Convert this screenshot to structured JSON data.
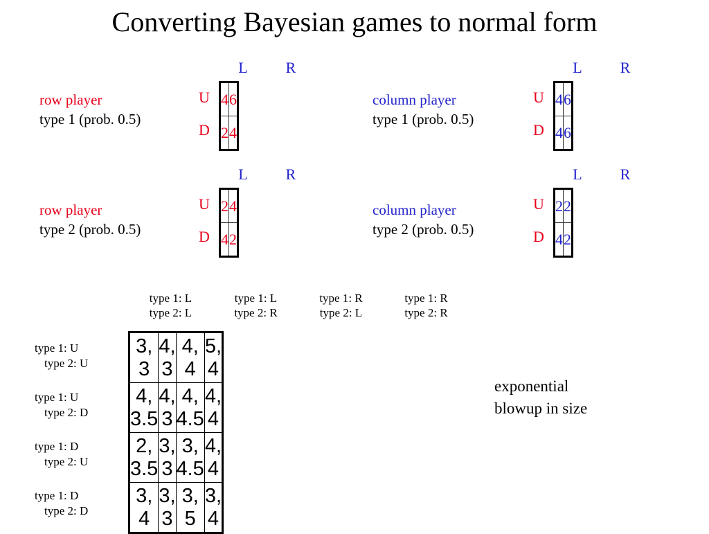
{
  "title": "Converting Bayesian games to normal form",
  "colors": {
    "row_player": "#e8001c",
    "column_player": "#2222cc",
    "text": "#000000",
    "background": "#ffffff"
  },
  "bayesian_games": [
    {
      "id": "row-player-type-1",
      "player_label": "row player",
      "type_label": "type 1 (prob. 0.5)",
      "column_headers": [
        "L",
        "R"
      ],
      "row_headers": [
        "U",
        "D"
      ],
      "payoffs": [
        [
          "4",
          "6"
        ],
        [
          "2",
          "4"
        ]
      ],
      "payoff_color": "#e8001c"
    },
    {
      "id": "column-player-type-1",
      "player_label": "column player",
      "type_label": "type 1 (prob. 0.5)",
      "column_headers": [
        "L",
        "R"
      ],
      "row_headers": [
        "U",
        "D"
      ],
      "payoffs": [
        [
          "4",
          "6"
        ],
        [
          "4",
          "6"
        ]
      ],
      "payoff_color": "#2222cc"
    },
    {
      "id": "row-player-type-2",
      "player_label": "row player",
      "type_label": "type 2 (prob. 0.5)",
      "column_headers": [
        "L",
        "R"
      ],
      "row_headers": [
        "U",
        "D"
      ],
      "payoffs": [
        [
          "2",
          "4"
        ],
        [
          "4",
          "2"
        ]
      ],
      "payoff_color": "#e8001c"
    },
    {
      "id": "column-player-type-2",
      "player_label": "column player",
      "type_label": "type 2 (prob. 0.5)",
      "column_headers": [
        "L",
        "R"
      ],
      "row_headers": [
        "U",
        "D"
      ],
      "payoffs": [
        [
          "2",
          "2"
        ],
        [
          "4",
          "2"
        ]
      ],
      "payoff_color": "#2222cc"
    }
  ],
  "normal_form": {
    "column_headers": [
      {
        "line1": "type 1: L",
        "line2": "type 2: L"
      },
      {
        "line1": "type 1: L",
        "line2": "type 2: R"
      },
      {
        "line1": "type 1: R",
        "line2": "type 2: L"
      },
      {
        "line1": "type 1: R",
        "line2": "type 2: R"
      }
    ],
    "row_headers": [
      {
        "line1": "type 1: U",
        "line2": "type 2: U"
      },
      {
        "line1": "type 1: U",
        "line2": "type 2: D"
      },
      {
        "line1": "type 1: D",
        "line2": "type 2: U"
      },
      {
        "line1": "type 1: D",
        "line2": "type 2: D"
      }
    ],
    "cells": [
      [
        "3, 3",
        "4, 3",
        "4, 4",
        "5, 4"
      ],
      [
        "4, 3.5",
        "4, 3",
        "4, 4.5",
        "4, 4"
      ],
      [
        "2, 3.5",
        "3, 3",
        "3, 4.5",
        "4, 4"
      ],
      [
        "3, 4",
        "3, 3",
        "3, 5",
        "3, 4"
      ]
    ]
  },
  "side_note": {
    "line1": "exponential",
    "line2": "blowup in size"
  }
}
